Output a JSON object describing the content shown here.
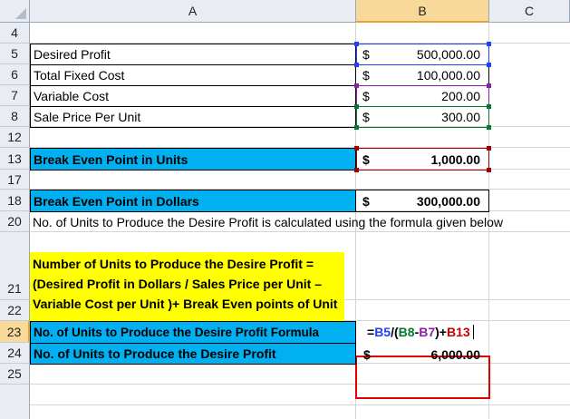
{
  "columns": [
    "A",
    "B",
    "C"
  ],
  "selected_column": "B",
  "rows": [
    "4",
    "5",
    "6",
    "7",
    "8",
    "12",
    "13",
    "17",
    "18",
    "20",
    "21",
    "22",
    "23",
    "24",
    "25"
  ],
  "selected_rows": [
    "23"
  ],
  "currency_symbol": "$",
  "inputs": [
    {
      "row": "5",
      "label": "Desired Profit",
      "value": "500,000.00",
      "ref_color": "#1f3fff"
    },
    {
      "row": "6",
      "label": "Total Fixed Cost",
      "value": "100,000.00",
      "ref_color": "#ffffff"
    },
    {
      "row": "7",
      "label": "Variable Cost",
      "value": "200.00",
      "ref_color": "#8b1fa8"
    },
    {
      "row": "8",
      "label": "Sale Price Per Unit",
      "value": "300.00",
      "ref_color": "#007a2e"
    }
  ],
  "bep_units": {
    "label": "Break Even Point in Units",
    "value": "1,000.00",
    "ref_color": "#a00000"
  },
  "bep_dollars": {
    "label": "Break Even Point in Dollars",
    "value": "300,000.00"
  },
  "note_row20": "No. of Units to Produce the Desire Profit is calculated using the formula given below",
  "note_row21": "Number of Units to Produce the Desire Profit = (Desired Profit in Dollars / Sales Price per Unit – Variable Cost per Unit )+ Break Even points of Unit",
  "formula_row": {
    "label": "No. of Units to Produce the Desire Profit Formula",
    "formula_parts": [
      "=",
      "B5",
      "/(",
      "B8",
      "-",
      "B7",
      ")+",
      "B13"
    ]
  },
  "result_row": {
    "label": "No. of Units to Produce the Desire Profit",
    "value": "6,000.00"
  },
  "colors": {
    "highlight_blue": "#00b0f0",
    "highlight_yellow": "#ffff00",
    "active_box": "#e00000",
    "header_selected": "#f9d99a"
  }
}
